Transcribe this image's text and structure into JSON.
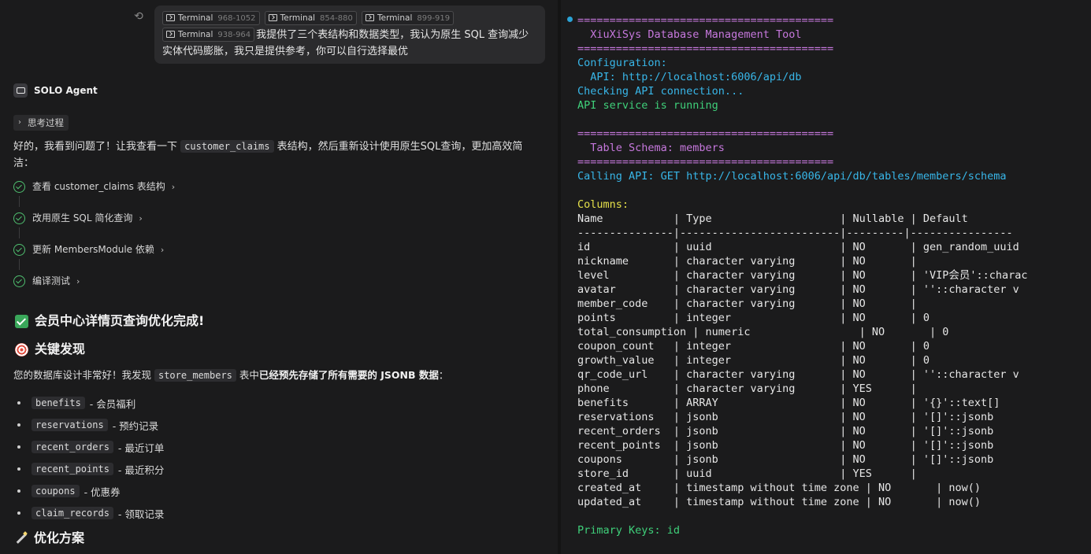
{
  "chat": {
    "user_message": {
      "terminals": [
        {
          "label": "Terminal",
          "range": "968-1052"
        },
        {
          "label": "Terminal",
          "range": "854-880"
        },
        {
          "label": "Terminal",
          "range": "899-919"
        },
        {
          "label": "Terminal",
          "range": "938-964"
        }
      ],
      "text_inline": "我",
      "text_rest": "提供了三个表结构和数据类型，我认为原生 SQL 查询减少实体代码膨胀，我只是提供参考，你可以自行选择最优"
    },
    "agent_name": "SOLO Agent",
    "think_label": "思考过程",
    "intro_a": "好的，我看到问题了！让我查看一下 ",
    "intro_code": "customer_claims",
    "intro_b": " 表结构，然后重新设计使用原生SQL查询，更加高效简洁：",
    "steps": [
      "查看 customer_claims 表结构",
      "改用原生 SQL 简化查询",
      "更新 MembersModule 依赖",
      "编译测试"
    ],
    "heading_done": "会员中心详情页查询优化完成!",
    "heading_findings": "关键发现",
    "findings_a": "您的数据库设计非常好！我发现 ",
    "findings_code": "store_members",
    "findings_b": " 表中",
    "findings_bold": "已经预先存储了所有需要的 JSONB 数据",
    "findings_c": "：",
    "fields": [
      {
        "code": "benefits",
        "desc": "- 会员福利"
      },
      {
        "code": "reservations",
        "desc": "- 预约记录"
      },
      {
        "code": "recent_orders",
        "desc": "- 最近订单"
      },
      {
        "code": "recent_points",
        "desc": "- 最近积分"
      },
      {
        "code": "coupons",
        "desc": "- 优惠券"
      },
      {
        "code": "claim_records",
        "desc": "- 领取记录"
      }
    ],
    "heading_plan": "优化方案"
  },
  "terminal": {
    "colors": {
      "magenta": "#c678dd",
      "cyan": "#38b6e8",
      "green": "#3fd07a",
      "yellow": "#e5e04a"
    },
    "lines": [
      {
        "text": "========================================",
        "color": "mag"
      },
      {
        "text": "  XiuXiSys Database Management Tool",
        "color": "mag"
      },
      {
        "text": "========================================",
        "color": "mag"
      },
      {
        "text": "Configuration:",
        "color": "cyan"
      },
      {
        "text": "  API: http://localhost:6006/api/db",
        "color": "cyan"
      },
      {
        "text": "Checking API connection...",
        "color": "cyan"
      },
      {
        "text": "API service is running",
        "color": "green"
      },
      {
        "text": "",
        "color": "white"
      },
      {
        "text": "========================================",
        "color": "mag"
      },
      {
        "text": "  Table Schema: members",
        "color": "mag"
      },
      {
        "text": "========================================",
        "color": "mag"
      },
      {
        "text": "Calling API: GET http://localhost:6006/api/db/tables/members/schema",
        "color": "cyan"
      },
      {
        "text": "",
        "color": "white"
      },
      {
        "text": "Columns:",
        "color": "yellow"
      },
      {
        "text": "Name           | Type                    | Nullable | Default",
        "color": "white"
      },
      {
        "text": "---------------|-------------------------|---------|----------------",
        "color": "white"
      },
      {
        "text": "id             | uuid                    | NO       | gen_random_uuid",
        "color": "white"
      },
      {
        "text": "nickname       | character varying       | NO       |",
        "color": "white"
      },
      {
        "text": "level          | character varying       | NO       | 'VIP会员'::charac",
        "color": "white"
      },
      {
        "text": "avatar         | character varying       | NO       | ''::character v",
        "color": "white"
      },
      {
        "text": "member_code    | character varying       | NO       |",
        "color": "white"
      },
      {
        "text": "points         | integer                 | NO       | 0",
        "color": "white"
      },
      {
        "text": "total_consumption | numeric                 | NO       | 0",
        "color": "white"
      },
      {
        "text": "coupon_count   | integer                 | NO       | 0",
        "color": "white"
      },
      {
        "text": "growth_value   | integer                 | NO       | 0",
        "color": "white"
      },
      {
        "text": "qr_code_url    | character varying       | NO       | ''::character v",
        "color": "white"
      },
      {
        "text": "phone          | character varying       | YES      |",
        "color": "white"
      },
      {
        "text": "benefits       | ARRAY                   | NO       | '{}'::text[]",
        "color": "white"
      },
      {
        "text": "reservations   | jsonb                   | NO       | '[]'::jsonb",
        "color": "white"
      },
      {
        "text": "recent_orders  | jsonb                   | NO       | '[]'::jsonb",
        "color": "white"
      },
      {
        "text": "recent_points  | jsonb                   | NO       | '[]'::jsonb",
        "color": "white"
      },
      {
        "text": "coupons        | jsonb                   | NO       | '[]'::jsonb",
        "color": "white"
      },
      {
        "text": "store_id       | uuid                    | YES      |",
        "color": "white"
      },
      {
        "text": "created_at     | timestamp without time zone | NO       | now()",
        "color": "white"
      },
      {
        "text": "updated_at     | timestamp without time zone | NO       | now()",
        "color": "white"
      },
      {
        "text": "",
        "color": "white"
      },
      {
        "text": "Primary Keys: id",
        "color": "green"
      }
    ]
  }
}
